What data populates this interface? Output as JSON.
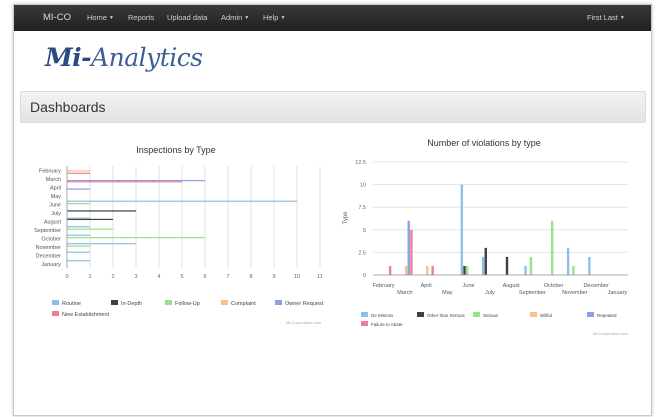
{
  "navbar": {
    "brand": "MI-CO",
    "items": [
      "Home",
      "Reports",
      "Upload data",
      "Admin",
      "Help"
    ],
    "user": "First Last"
  },
  "logo": {
    "mi": "Mi-",
    "rest": "Analytics"
  },
  "page": {
    "title": "Dashboards"
  },
  "colors": {
    "routine": "#8fbfe4",
    "in_depth": "#3f3f3f",
    "follow_up": "#9be08a",
    "complaint": "#f5c28a",
    "owner_request": "#8da0e5",
    "new_establishment": "#ef7f95"
  },
  "chart_data": [
    {
      "type": "bar",
      "orientation": "horizontal",
      "title": "Inspections by Type",
      "categories": [
        "February",
        "March",
        "April",
        "May",
        "June",
        "July",
        "August",
        "September",
        "October",
        "November",
        "December",
        "January"
      ],
      "xlim": [
        0,
        11
      ],
      "xticks": [
        "0",
        "1",
        "2",
        "3",
        "4",
        "5",
        "6",
        "7",
        "8",
        "9",
        "10",
        "11"
      ],
      "series": [
        {
          "name": "Routine",
          "color": "#8fbfe4",
          "values": [
            0,
            0,
            0,
            0,
            10,
            0,
            1,
            1,
            1,
            3,
            1,
            1
          ]
        },
        {
          "name": "In-Depth",
          "color": "#3f3f3f",
          "values": [
            0,
            0,
            0,
            0,
            0,
            3,
            2,
            0,
            0,
            0,
            0,
            0
          ]
        },
        {
          "name": "Follow-Up",
          "color": "#9be08a",
          "values": [
            0,
            0,
            0,
            0,
            1,
            0,
            0,
            2,
            6,
            1,
            0,
            0
          ]
        },
        {
          "name": "Complaint",
          "color": "#f5c28a",
          "values": [
            1,
            0,
            0,
            0,
            0,
            0,
            0,
            0,
            0,
            0,
            0,
            0
          ]
        },
        {
          "name": "Owner Request",
          "color": "#8da0e5",
          "values": [
            0,
            6,
            1,
            0,
            0,
            0,
            0,
            0,
            0,
            0,
            0,
            0
          ]
        },
        {
          "name": "New Establishment",
          "color": "#ef7f95",
          "values": [
            1,
            5,
            0,
            0,
            0,
            0,
            0,
            0,
            0,
            0,
            0,
            0
          ]
        }
      ],
      "credit": "Mi-Corporation.com"
    },
    {
      "type": "bar",
      "title": "Number of violations by type",
      "ylabel": "Type",
      "categories": [
        "February",
        "March",
        "April",
        "May",
        "June",
        "July",
        "August",
        "September",
        "October",
        "November",
        "December",
        "January"
      ],
      "ylim": [
        0,
        12.5
      ],
      "yticks": [
        "0",
        "2.5",
        "5",
        "7.5",
        "10",
        "12.5"
      ],
      "series": [
        {
          "name": "De Minimis",
          "color": "#8fbfe4",
          "values": [
            0,
            0,
            0,
            0,
            10,
            2,
            0,
            1,
            0,
            3,
            2,
            0
          ]
        },
        {
          "name": "Other than Serious",
          "color": "#3f3f3f",
          "values": [
            0,
            0,
            0,
            0,
            1,
            3,
            2,
            0,
            0,
            0,
            0,
            0
          ]
        },
        {
          "name": "Serious",
          "color": "#9be08a",
          "values": [
            0,
            0,
            0,
            0,
            1,
            0,
            0,
            2,
            6,
            1,
            0,
            0
          ]
        },
        {
          "name": "Willful",
          "color": "#f5c28a",
          "values": [
            0,
            1,
            1,
            0,
            0,
            0,
            0,
            0,
            0,
            0,
            0,
            0
          ]
        },
        {
          "name": "Repeated",
          "color": "#8da0e5",
          "values": [
            0,
            6,
            0,
            0,
            0,
            0,
            0,
            0,
            0,
            0,
            0,
            0
          ]
        },
        {
          "name": "Failure to Abate",
          "color": "#ef7f95",
          "values": [
            1,
            5,
            1,
            0,
            0,
            0,
            0,
            0,
            0,
            0,
            0,
            0
          ]
        }
      ],
      "credit": "Mi-Corporation.com"
    }
  ]
}
